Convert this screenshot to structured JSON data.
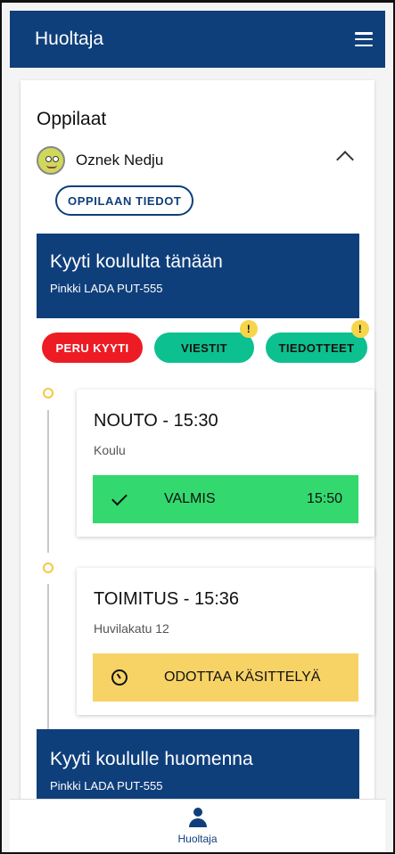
{
  "appbar": {
    "title": "Huoltaja"
  },
  "students": {
    "section_title": "Oppilaat",
    "student_name": "Oznek Nedju",
    "info_button": "OPPILAAN TIEDOT"
  },
  "trip_today": {
    "title": "Kyyti koululta tänään",
    "vehicle": "Pinkki LADA PUT-555",
    "actions": {
      "cancel": "PERU KYYTI",
      "messages": "VIESTIT",
      "messages_badge": "!",
      "notices": "TIEDOTTEET",
      "notices_badge": "!"
    },
    "stops": [
      {
        "title": "NOUTO - 15:30",
        "place": "Koulu",
        "status": "VALMIS",
        "status_time": "15:50"
      },
      {
        "title": "TOIMITUS - 15:36",
        "place": "Huvilakatu 12",
        "status": "ODOTTAA KÄSITTELYÄ",
        "status_time": ""
      }
    ]
  },
  "trip_tomorrow": {
    "title": "Kyyti koululle huomenna",
    "vehicle": "Pinkki LADA PUT-555"
  },
  "bottom_nav": {
    "label": "Huoltaja"
  },
  "colors": {
    "primary": "#0f3f7b",
    "danger": "#ed1c24",
    "success_pill": "#0cc18f",
    "done": "#33d96e",
    "waiting": "#f7d366"
  }
}
